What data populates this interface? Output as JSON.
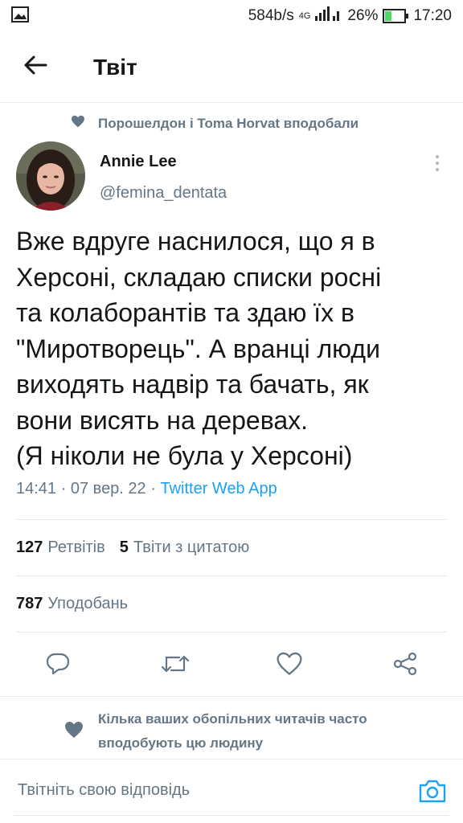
{
  "status_bar": {
    "network_speed": "584b/s",
    "network_type": "4G",
    "battery_percent": "26%",
    "time": "17:20"
  },
  "header": {
    "title": "Твіт"
  },
  "social_context": {
    "text": "Порошелдон і Toma Horvat вподобали"
  },
  "tweet": {
    "author_name": "Annie Lee",
    "author_handle": "@femina_dentata",
    "text": "Вже вдруге наснилося, що я в\nХерсоні, складаю списки росні\nта колаборантів та здаю їх в\n\"Миротворець\". А вранці люди\nвиходять надвір та бачать, як\nвони висять на деревах.\n(Я ніколи не була у Херсоні)",
    "time": "14:41",
    "date": "07 вер. 22",
    "separator": "·",
    "source": "Twitter Web App"
  },
  "stats": {
    "retweets_count": "127",
    "retweets_label": "Ретвітів",
    "quotes_count": "5",
    "quotes_label": "Твіти з цитатою",
    "likes_count": "787",
    "likes_label": "Уподобань"
  },
  "recommendation": {
    "text": "Кілька ваших обопільних читачів часто вподобують цю людину"
  },
  "reply": {
    "placeholder": "Твітніть свою відповідь"
  },
  "colors": {
    "accent": "#1da1f2",
    "secondary_text": "#657786",
    "primary_text": "#14171a",
    "divider": "#e1e8ed"
  },
  "icons": {
    "back": "arrow-left-icon",
    "heart": "heart-icon",
    "more": "more-vertical-icon",
    "reply": "reply-bubble-icon",
    "retweet": "retweet-icon",
    "like": "heart-outline-icon",
    "share": "share-icon",
    "camera": "camera-icon"
  }
}
